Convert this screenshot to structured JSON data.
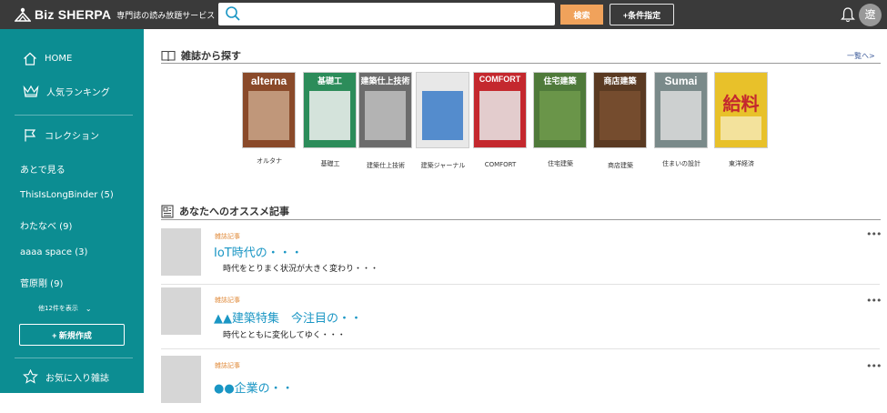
{
  "header": {
    "logo_text": "Biz SHERPA",
    "logo_sub": "専門誌の読み放題サービス",
    "search_placeholder": "",
    "search_button": "検索",
    "condition_button": "+条件指定",
    "avatar_initial": "遼"
  },
  "sidebar": {
    "home": "HOME",
    "ranking": "人気ランキング",
    "collection": "コレクション",
    "links": [
      "あとで見る",
      "ThisIsLongBinder (5)",
      "わたなべ (9)",
      "aaaa space (3)",
      "菅原剛 (9)"
    ],
    "more": "他12件を表示",
    "new_button": "+ 新規作成",
    "favorites": "お気に入り雑誌"
  },
  "magazines_section": {
    "title": "雑誌から探す",
    "more": "一覧へ>",
    "items": [
      {
        "name": "オルタナ",
        "cover_text": "alterna",
        "color": "#8a4a2a"
      },
      {
        "name": "基礎工",
        "cover_text": "基礎工",
        "color": "#2c8c5a"
      },
      {
        "name": "建築仕上技術",
        "cover_text": "建築仕上技術",
        "color": "#6c6c6c"
      },
      {
        "name": "建築ジャーナル",
        "cover_text": "",
        "color": "#e8e8e8"
      },
      {
        "name": "COMFORT",
        "cover_text": "COMFORT",
        "color": "#c4282e"
      },
      {
        "name": "住宅建築",
        "cover_text": "住宅建築",
        "color": "#4f7a3a"
      },
      {
        "name": "商店建築",
        "cover_text": "商店建築",
        "color": "#5a3a22"
      },
      {
        "name": "住まいの設計",
        "cover_text": "Sumai",
        "color": "#7a8a8a"
      },
      {
        "name": "東洋経済",
        "cover_text": "給料",
        "color": "#e8c12a"
      }
    ]
  },
  "recommend_section": {
    "title": "あなたへのオススメ記事",
    "articles": [
      {
        "type": "雑誌記事",
        "title": "IoT時代の・・・",
        "desc": "時代をとりまく状況が大きく変わり・・・"
      },
      {
        "type": "雑誌記事",
        "title": "▲▲建築特集　今注目の・・",
        "desc": "時代とともに変化してゆく・・・"
      },
      {
        "type": "雑誌記事",
        "title": "●●企業の・・",
        "desc": ""
      }
    ],
    "menu_glyph": "•••"
  }
}
